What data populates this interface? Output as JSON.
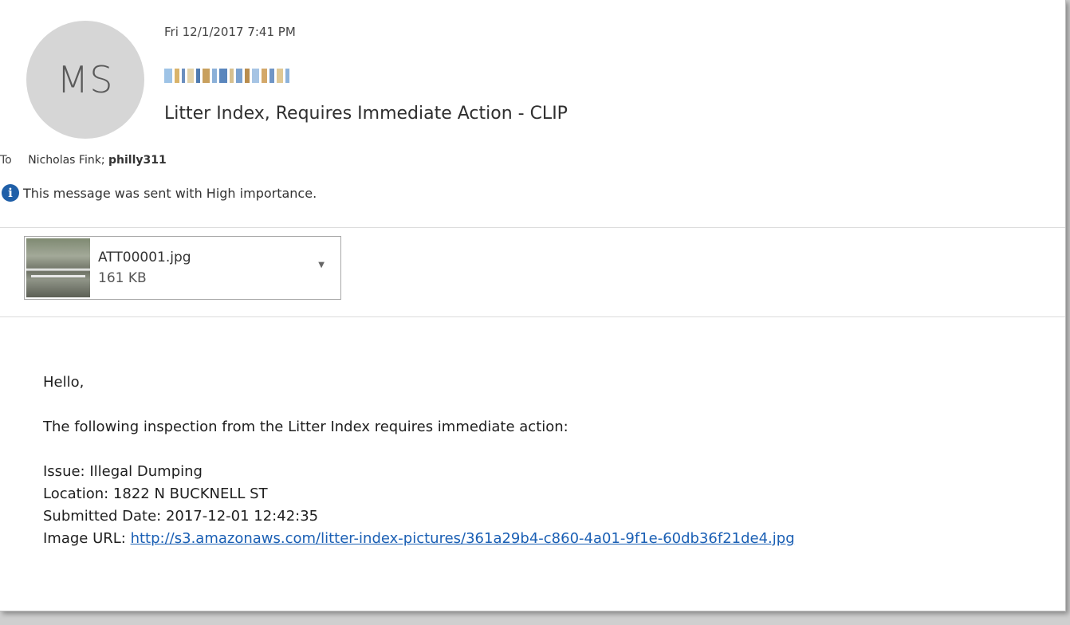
{
  "header": {
    "avatar_initials": "MS",
    "date": "Fri 12/1/2017 7:41 PM",
    "subject": "Litter Index, Requires Immediate Action - CLIP",
    "to_label": "To",
    "recipient_1": "Nicholas Fink;",
    "recipient_2": "philly311",
    "importance_note": "This message was sent with High importance."
  },
  "attachment": {
    "name": "ATT00001.jpg",
    "size": "161 KB"
  },
  "body": {
    "greeting": "Hello,",
    "intro": "The following inspection from the Litter Index requires immediate action:",
    "issue": "Issue: Illegal Dumping",
    "location": "Location: 1822 N BUCKNELL ST",
    "submitted": "Submitted Date: 2017-12-01 12:42:35",
    "image_label": "Image URL: ",
    "image_url": "http://s3.amazonaws.com/litter-index-pictures/361a29b4-c860-4a01-9f1e-60db36f21de4.jpg"
  },
  "colors": {
    "info_icon": "#1f5fa8",
    "link": "#1a5fb4",
    "avatar_bg": "#d6d6d6"
  },
  "icons": {
    "info": "info-icon",
    "dropdown": "chevron-down-icon"
  }
}
